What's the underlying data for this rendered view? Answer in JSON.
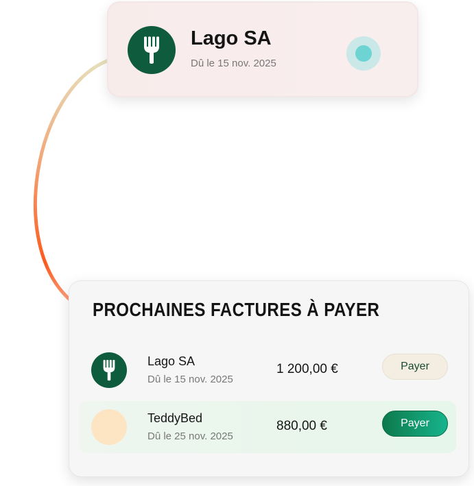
{
  "notification": {
    "company": "Lago SA",
    "due": "Dû le 15 nov. 2025",
    "icon": "fork-icon"
  },
  "upcoming": {
    "title": "PROCHAINES FACTURES À PAYER",
    "rows": [
      {
        "company": "Lago SA",
        "due": "Dû le 15 nov. 2025",
        "amount": "1 200,00 €",
        "pay_label": "Payer",
        "icon": "fork-icon"
      },
      {
        "company": "TeddyBed",
        "due": "Dû le 25 nov. 2025",
        "amount": "880,00 €",
        "pay_label": "Payer",
        "icon": "moon-icon"
      }
    ]
  },
  "colors": {
    "brand_green": "#0e5b3d",
    "pay_button_gradient": [
      "#0d7a4c",
      "#17b48d"
    ],
    "status_dot": "#6dd3d3",
    "connector_gradient": [
      "#e3dcb4",
      "#f5803a",
      "#fc4a14"
    ]
  }
}
